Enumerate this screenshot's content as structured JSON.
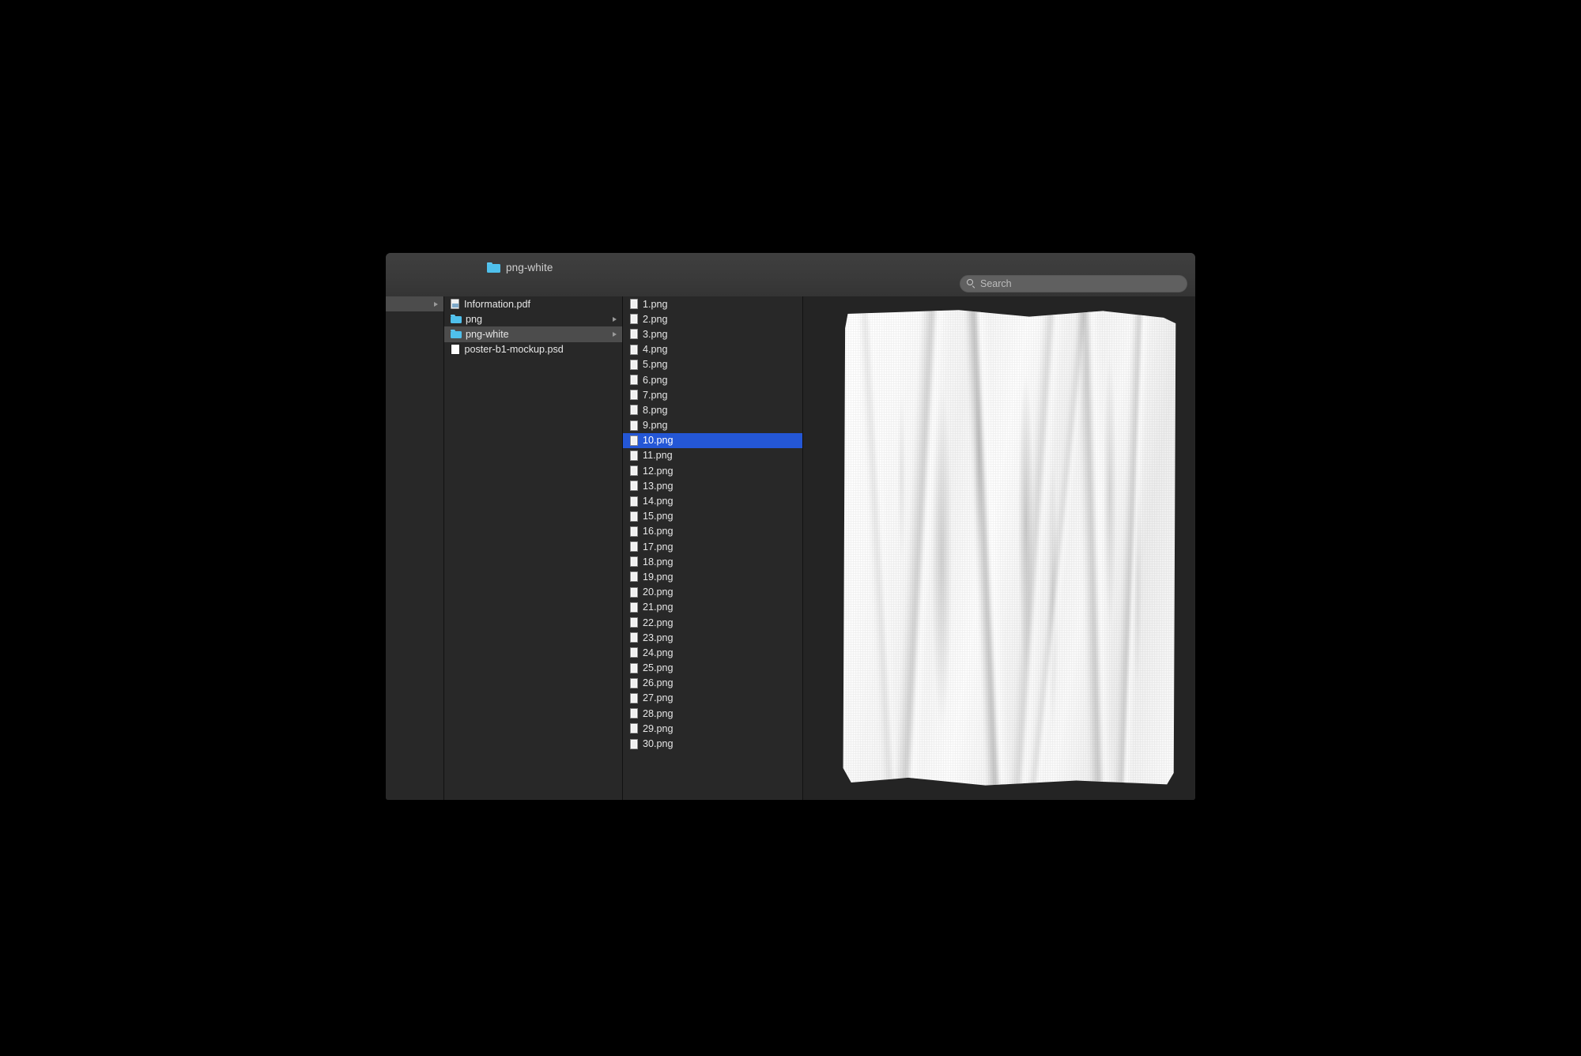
{
  "window": {
    "title": "png-white",
    "title_icon": "folder-icon"
  },
  "toolbar": {
    "search": {
      "icon": "search-icon",
      "placeholder": "Search",
      "value": ""
    }
  },
  "colors": {
    "selection_active": "#2457d6",
    "selection_inactive": "#4c4c4c",
    "folder_blue": "#4fc0ec",
    "window_chrome": "#3a3a3a",
    "column_background": "#282828"
  },
  "browser": {
    "columns": [
      {
        "name": "column-ancestor",
        "rows": [
          {
            "icon": "",
            "label": "",
            "selected": "gray",
            "has_arrow": true
          }
        ]
      },
      {
        "name": "column-parent",
        "rows": [
          {
            "icon": "pdf-icon",
            "label": "Information.pdf",
            "selected": "none",
            "has_arrow": false
          },
          {
            "icon": "folder-icon",
            "label": "png",
            "selected": "none",
            "has_arrow": true
          },
          {
            "icon": "folder-icon",
            "label": "png-white",
            "selected": "gray",
            "has_arrow": true
          },
          {
            "icon": "psd-icon",
            "label": "poster-b1-mockup.psd",
            "selected": "none",
            "has_arrow": false
          }
        ]
      },
      {
        "name": "column-files",
        "rows": [
          {
            "icon": "png-icon",
            "label": "1.png",
            "selected": "none",
            "has_arrow": false
          },
          {
            "icon": "png-icon",
            "label": "2.png",
            "selected": "none",
            "has_arrow": false
          },
          {
            "icon": "png-icon",
            "label": "3.png",
            "selected": "none",
            "has_arrow": false
          },
          {
            "icon": "png-icon",
            "label": "4.png",
            "selected": "none",
            "has_arrow": false
          },
          {
            "icon": "png-icon",
            "label": "5.png",
            "selected": "none",
            "has_arrow": false
          },
          {
            "icon": "png-icon",
            "label": "6.png",
            "selected": "none",
            "has_arrow": false
          },
          {
            "icon": "png-icon",
            "label": "7.png",
            "selected": "none",
            "has_arrow": false
          },
          {
            "icon": "png-icon",
            "label": "8.png",
            "selected": "none",
            "has_arrow": false
          },
          {
            "icon": "png-icon",
            "label": "9.png",
            "selected": "none",
            "has_arrow": false
          },
          {
            "icon": "png-icon",
            "label": "10.png",
            "selected": "blue",
            "has_arrow": false
          },
          {
            "icon": "png-icon",
            "label": "11.png",
            "selected": "none",
            "has_arrow": false
          },
          {
            "icon": "png-icon",
            "label": "12.png",
            "selected": "none",
            "has_arrow": false
          },
          {
            "icon": "png-icon",
            "label": "13.png",
            "selected": "none",
            "has_arrow": false
          },
          {
            "icon": "png-icon",
            "label": "14.png",
            "selected": "none",
            "has_arrow": false
          },
          {
            "icon": "png-icon",
            "label": "15.png",
            "selected": "none",
            "has_arrow": false
          },
          {
            "icon": "png-icon",
            "label": "16.png",
            "selected": "none",
            "has_arrow": false
          },
          {
            "icon": "png-icon",
            "label": "17.png",
            "selected": "none",
            "has_arrow": false
          },
          {
            "icon": "png-icon",
            "label": "18.png",
            "selected": "none",
            "has_arrow": false
          },
          {
            "icon": "png-icon",
            "label": "19.png",
            "selected": "none",
            "has_arrow": false
          },
          {
            "icon": "png-icon",
            "label": "20.png",
            "selected": "none",
            "has_arrow": false
          },
          {
            "icon": "png-icon",
            "label": "21.png",
            "selected": "none",
            "has_arrow": false
          },
          {
            "icon": "png-icon",
            "label": "22.png",
            "selected": "none",
            "has_arrow": false
          },
          {
            "icon": "png-icon",
            "label": "23.png",
            "selected": "none",
            "has_arrow": false
          },
          {
            "icon": "png-icon",
            "label": "24.png",
            "selected": "none",
            "has_arrow": false
          },
          {
            "icon": "png-icon",
            "label": "25.png",
            "selected": "none",
            "has_arrow": false
          },
          {
            "icon": "png-icon",
            "label": "26.png",
            "selected": "none",
            "has_arrow": false
          },
          {
            "icon": "png-icon",
            "label": "27.png",
            "selected": "none",
            "has_arrow": false
          },
          {
            "icon": "png-icon",
            "label": "28.png",
            "selected": "none",
            "has_arrow": false
          },
          {
            "icon": "png-icon",
            "label": "29.png",
            "selected": "none",
            "has_arrow": false
          },
          {
            "icon": "png-icon",
            "label": "30.png",
            "selected": "none",
            "has_arrow": false
          }
        ]
      }
    ]
  },
  "preview": {
    "name": "preview-pane",
    "content": "crumpled-white-poster-image"
  }
}
